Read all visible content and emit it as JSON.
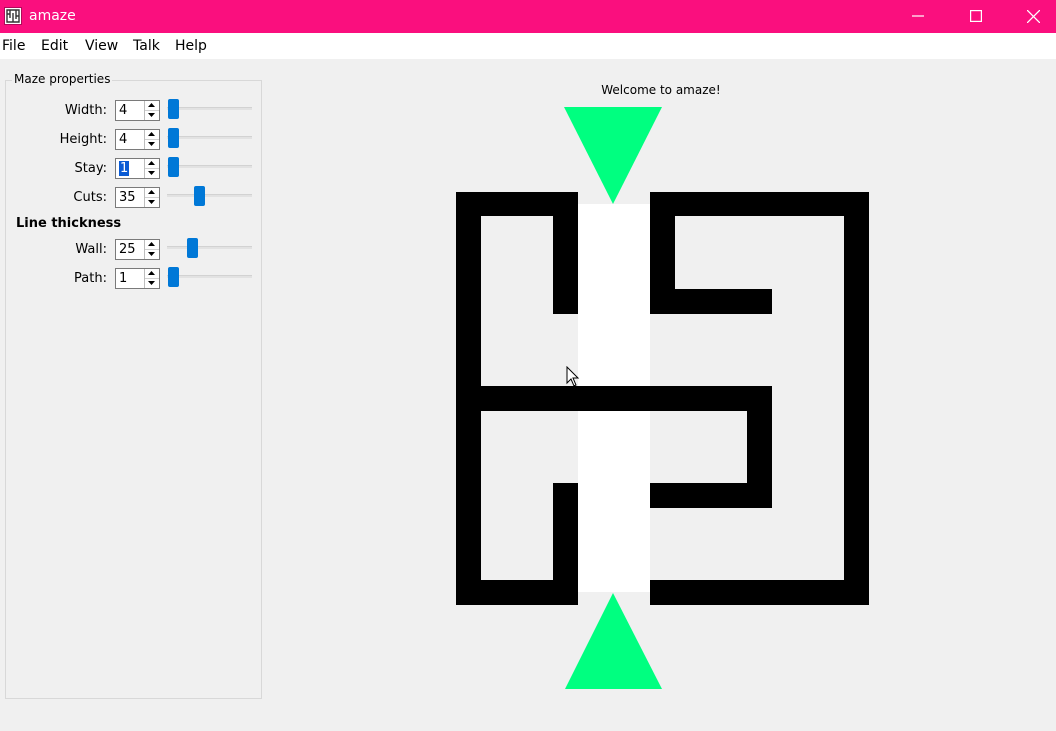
{
  "window": {
    "title": "amaze",
    "titlebar_color": "#fa0f7e"
  },
  "menu": [
    "File",
    "Edit",
    "View",
    "Talk",
    "Help"
  ],
  "panel": {
    "title": "Maze properties",
    "fields": [
      {
        "label": "Width:",
        "value": "4",
        "slider_fraction": 0.0
      },
      {
        "label": "Height:",
        "value": "4",
        "slider_fraction": 0.0
      },
      {
        "label": "Stay:",
        "value": "1",
        "slider_fraction": 0.0
      },
      {
        "label": "Cuts:",
        "value": "35",
        "slider_fraction": 0.35
      }
    ],
    "line_heading": "Line thickness",
    "line_fields": [
      {
        "label": "Wall:",
        "value": "25",
        "slider_fraction": 0.25
      },
      {
        "label": "Path:",
        "value": "1",
        "slider_fraction": 0.0
      }
    ]
  },
  "canvas": {
    "message": "Welcome to amaze!",
    "wall_color": "#000000",
    "path_color": "#ffffff",
    "arrow_color": "#00ff80"
  }
}
